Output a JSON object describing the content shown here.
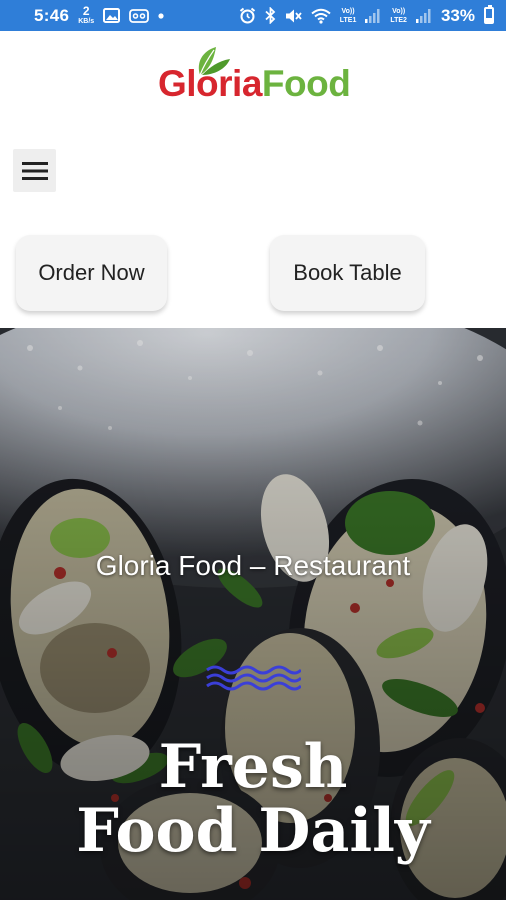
{
  "status_bar": {
    "time": "5:46",
    "net_speed_value": "2",
    "net_speed_unit": "KB/s",
    "sim1_label_top": "Vo))",
    "sim1_label_bottom": "LTE1",
    "sim2_label_top": "Vo))",
    "sim2_label_bottom": "LTE2",
    "battery_percent": "33%",
    "battery_level": 0.33,
    "icons": [
      "image-icon",
      "voicemail-icon",
      "dot-icon",
      "alarm-icon",
      "bluetooth-icon",
      "mute-icon",
      "wifi-icon",
      "signal-icon",
      "battery-icon"
    ],
    "color": "#2f7ed8"
  },
  "header": {
    "logo_part1": "Gloria",
    "logo_part2": "Food",
    "logo_color_red": "#d7262e",
    "logo_color_green": "#6cb33f"
  },
  "menu": {
    "icon": "hamburger-menu-icon"
  },
  "actions": {
    "order_label": "Order Now",
    "book_label": "Book Table"
  },
  "hero": {
    "subtitle": "Gloria Food – Restaurant",
    "title_line1": "Fresh",
    "title_line2": "Food Daily",
    "wave_color": "#3b3fd8"
  }
}
